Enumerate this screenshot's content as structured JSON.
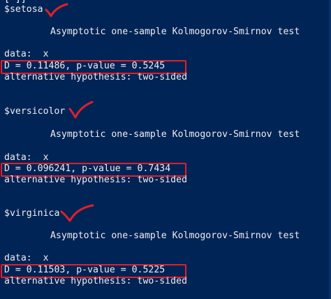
{
  "console": {
    "clipped_top_text": "[ ]]",
    "blocks": [
      {
        "name": "$setosa",
        "title": "Asymptotic one-sample Kolmogorov-Smirnov test",
        "data_line": "data:  x",
        "stat_line": "D = 0.11486, p-value = 0.5245",
        "alt_line": "alternative hypothesis: two-sided"
      },
      {
        "name": "$versicolor",
        "title": "Asymptotic one-sample Kolmogorov-Smirnov test",
        "data_line": "data:  x",
        "stat_line": "D = 0.096241, p-value = 0.7434",
        "alt_line": "alternative hypothesis: two-sided"
      },
      {
        "name": "$virginica",
        "title": "Asymptotic one-sample Kolmogorov-Smirnov test",
        "data_line": "data:  x",
        "stat_line": "D = 0.11503, p-value = 0.5225",
        "alt_line": "alternative hypothesis: two-sided"
      }
    ]
  },
  "annotations": {
    "highlight_color": "#e0202a",
    "checkmark_icon": "red-checkmark-icon",
    "highlight_icon": "red-rectangle-highlight"
  },
  "theme": {
    "background": "#012456",
    "text": "#eeedf0"
  }
}
